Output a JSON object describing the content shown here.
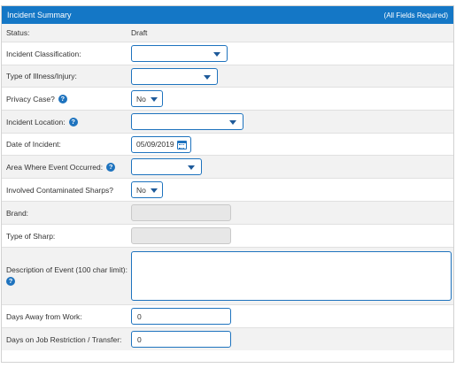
{
  "header": {
    "title": "Incident Summary",
    "required_note": "(All Fields Required)"
  },
  "rows": {
    "status": {
      "label": "Status:",
      "value": "Draft"
    },
    "classification": {
      "label": "Incident Classification:",
      "value": ""
    },
    "illness": {
      "label": "Type of Illness/Injury:",
      "value": ""
    },
    "privacy": {
      "label": "Privacy Case?",
      "value": "No"
    },
    "location": {
      "label": "Incident Location:",
      "value": ""
    },
    "date": {
      "label": "Date of Incident:",
      "value": "05/09/2019"
    },
    "area": {
      "label": "Area Where Event Occurred:",
      "value": ""
    },
    "sharps": {
      "label": "Involved Contaminated Sharps?",
      "value": "No"
    },
    "brand": {
      "label": "Brand:",
      "value": ""
    },
    "sharp_type": {
      "label": "Type of Sharp:",
      "value": ""
    },
    "description": {
      "label": "Description of Event (100 char limit):",
      "value": ""
    },
    "days_away": {
      "label": "Days Away from Work:",
      "value": "0"
    },
    "days_restriction": {
      "label": "Days on Job Restriction / Transfer:",
      "value": "0"
    }
  },
  "icons": {
    "help": "help-circle-icon",
    "calendar": "calendar-icon",
    "dropdown": "chevron-down-icon"
  },
  "help_glyph": "?",
  "colors": {
    "header_bg": "#1477c6",
    "accent": "#1e73be",
    "alt_row": "#f2f2f2",
    "disabled_bg": "#e7e7e7"
  }
}
